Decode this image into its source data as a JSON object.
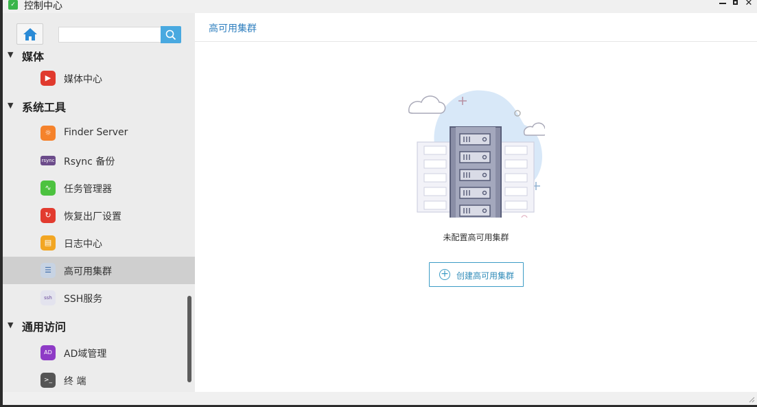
{
  "window": {
    "title": "控制中心"
  },
  "sidebar": {
    "search": {
      "value": "",
      "placeholder": ""
    },
    "partial_group_label": "媒体",
    "items_top": [
      {
        "label": "媒体中心",
        "icon": "play-icon",
        "color": "#e03a2e"
      }
    ],
    "groups": [
      {
        "label": "系统工具",
        "items": [
          {
            "label": "Finder Server",
            "icon": "finder-icon",
            "color": "#f5822b"
          },
          {
            "label": "Rsync 备份",
            "icon": "rsync-icon",
            "color": "#6b4b8a"
          },
          {
            "label": "任务管理器",
            "icon": "pulse-icon",
            "color": "#4cc23f"
          },
          {
            "label": "恢复出厂设置",
            "icon": "reset-icon",
            "color": "#e23b2f"
          },
          {
            "label": "日志中心",
            "icon": "log-icon",
            "color": "#f2a623"
          },
          {
            "label": "高可用集群",
            "icon": "cluster-icon",
            "color": "#b8c4d6",
            "selected": true
          },
          {
            "label": "SSH服务",
            "icon": "ssh-icon",
            "color": "#d9d9e8"
          }
        ]
      },
      {
        "label": "通用访问",
        "items": [
          {
            "label": "AD域管理",
            "icon": "ad-icon",
            "color": "#8e3bc6"
          },
          {
            "label": "终 端",
            "icon": "terminal-icon",
            "color": "#555555"
          }
        ]
      }
    ]
  },
  "main": {
    "title": "高可用集群",
    "empty_message": "未配置高可用集群",
    "create_button_label": "创建高可用集群"
  },
  "colors": {
    "accent": "#3b9bc5",
    "selected_row": "#cfcfcf"
  }
}
